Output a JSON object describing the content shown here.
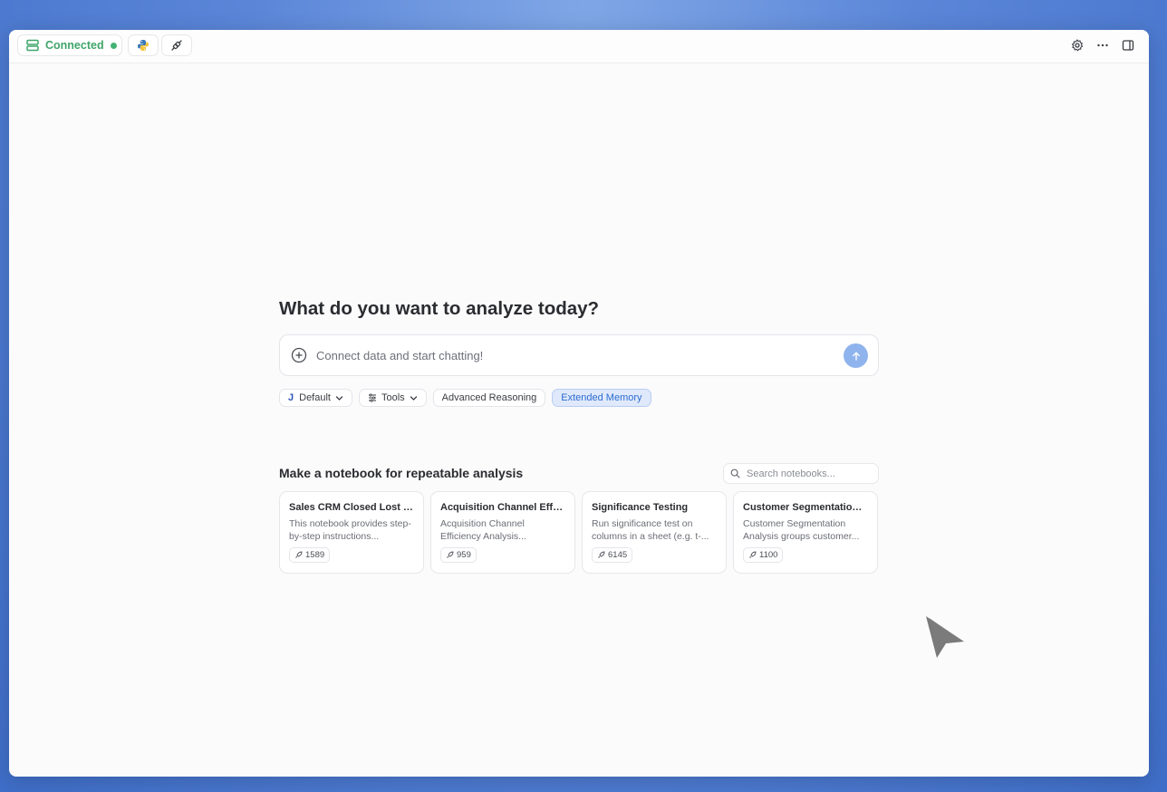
{
  "topbar": {
    "connection_label": "Connected",
    "connection_status_color": "#43b374",
    "python_icon": "python-icon",
    "plug_icon": "plug-icon",
    "right_icons": [
      "gear-icon",
      "more-icon",
      "sidebar-toggle-icon"
    ]
  },
  "main": {
    "heading": "What do you want to analyze today?",
    "chat": {
      "placeholder": "Connect data and start chatting!"
    },
    "chips": {
      "model_prefix": "J",
      "model_label": "Default",
      "tools_label": "Tools",
      "advanced_label": "Advanced Reasoning",
      "memory_label": "Extended Memory"
    },
    "notebooks": {
      "section_title": "Make a notebook for repeatable analysis",
      "search_placeholder": "Search notebooks...",
      "cards": [
        {
          "title": "Sales CRM Closed Lost R...",
          "desc": "This notebook provides step-by-step instructions...",
          "count": "1589"
        },
        {
          "title": "Acquisition Channel Effici...",
          "desc": "Acquisition Channel Efficiency Analysis...",
          "count": "959"
        },
        {
          "title": "Significance Testing",
          "desc": "Run significance test on columns in a sheet (e.g. t-...",
          "count": "6145"
        },
        {
          "title": "Customer Segmentation ...",
          "desc": "Customer Segmentation Analysis groups customer...",
          "count": "1100"
        }
      ]
    }
  },
  "colors": {
    "accent": "#2d6bd0",
    "send_button": "#8fb3ec",
    "connected_green": "#3fa56a"
  }
}
